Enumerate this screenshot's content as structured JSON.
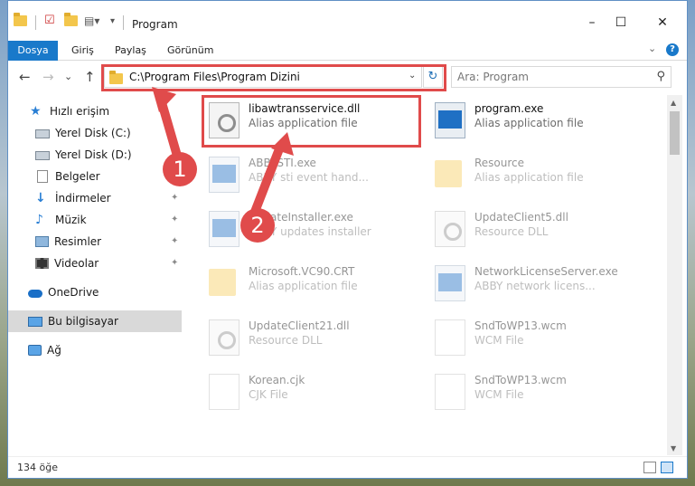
{
  "window": {
    "title": "Program",
    "controls": {
      "minimize": "–",
      "maximize": "☐",
      "close": "✕"
    }
  },
  "ribbon": {
    "tabs": [
      "Dosya",
      "Giriş",
      "Paylaş",
      "Görünüm"
    ],
    "help": "?"
  },
  "nav": {
    "back": "←",
    "forward": "→",
    "recent": "⌄",
    "up": "↑",
    "address": "C:\\Program Files\\Program Dizini",
    "refresh": "↻",
    "search_placeholder": "Ara: Program",
    "search_icon": "⚲"
  },
  "sidebar": {
    "items": [
      {
        "label": "Hızlı erişim",
        "icon": "star-icon"
      },
      {
        "label": "Yerel Disk (C:)",
        "icon": "drive-icon"
      },
      {
        "label": "Yerel Disk (D:)",
        "icon": "drive-icon"
      },
      {
        "label": "Belgeler",
        "icon": "document-icon"
      },
      {
        "label": "İndirmeler",
        "icon": "download-icon",
        "pinned": true
      },
      {
        "label": "Müzik",
        "icon": "music-icon",
        "pinned": true
      },
      {
        "label": "Resimler",
        "icon": "pictures-icon",
        "pinned": true
      },
      {
        "label": "Videolar",
        "icon": "video-icon",
        "pinned": true
      },
      {
        "label": "OneDrive",
        "icon": "cloud-icon"
      },
      {
        "label": "Bu bilgisayar",
        "icon": "computer-icon",
        "selected": true
      },
      {
        "label": "Ağ",
        "icon": "network-icon"
      }
    ],
    "pin_glyph": "📌"
  },
  "files": [
    {
      "name": "libawtransservice.dll",
      "type": "Alias application file",
      "icon": "dll"
    },
    {
      "name": "program.exe",
      "type": "Alias application file",
      "icon": "exe"
    },
    {
      "name": "ABBYSTI.exe",
      "type": "ABBY sti event hand...",
      "icon": "exe"
    },
    {
      "name": "Resource",
      "type": "Alias application file",
      "icon": "folder"
    },
    {
      "name": "UpdateInstaller.exe",
      "type": "ABBY updates installer",
      "icon": "exe"
    },
    {
      "name": "UpdateClient5.dll",
      "type": "Resource DLL",
      "icon": "dll"
    },
    {
      "name": "Microsoft.VC90.CRT",
      "type": "Alias application file",
      "icon": "folder"
    },
    {
      "name": "NetworkLicenseServer.exe",
      "type": "ABBY network licens...",
      "icon": "exe"
    },
    {
      "name": "UpdateClient21.dll",
      "type": "Resource DLL",
      "icon": "dll"
    },
    {
      "name": "SndToWP13.wcm",
      "type": "WCM File",
      "icon": "blank"
    },
    {
      "name": "Korean.cjk",
      "type": "CJK File",
      "icon": "blank"
    },
    {
      "name": "SndToWP13.wcm",
      "type": "WCM File",
      "icon": "blank"
    }
  ],
  "status": {
    "count": "134 öğe"
  },
  "annotations": {
    "badge1": "1",
    "badge2": "2",
    "color": "#e04b4b"
  }
}
